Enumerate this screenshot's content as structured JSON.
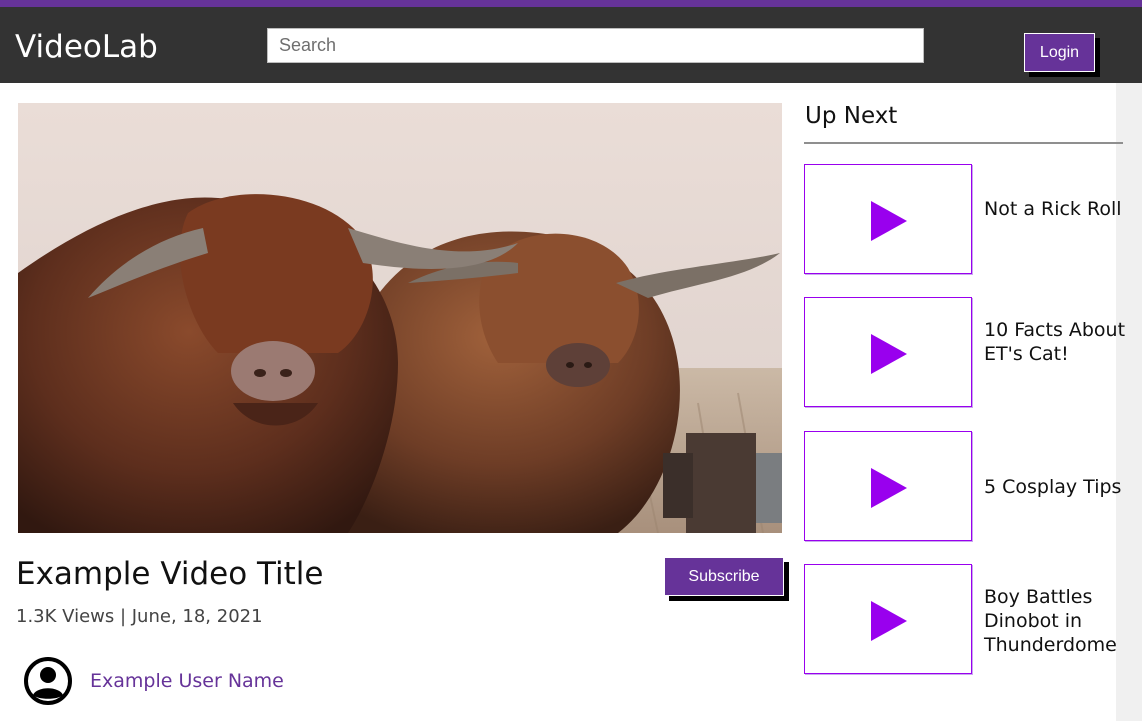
{
  "app": {
    "logo": "VideoLab",
    "search_placeholder": "Search",
    "login_label": "Login",
    "accent_color": "#663399",
    "play_color": "#9900ee"
  },
  "video": {
    "title": "Example Video Title",
    "meta": "1.3K Views | June, 18, 2021",
    "subscribe_label": "Subscribe",
    "user_name": "Example User Name"
  },
  "up_next": {
    "heading": "Up Next",
    "items": [
      {
        "label": "Not a Rick Roll"
      },
      {
        "label": "10 Facts About ET's Cat!"
      },
      {
        "label": "5 Cosplay Tips"
      },
      {
        "label": "Boy Battles Dinobot in Thunderdome"
      }
    ]
  }
}
